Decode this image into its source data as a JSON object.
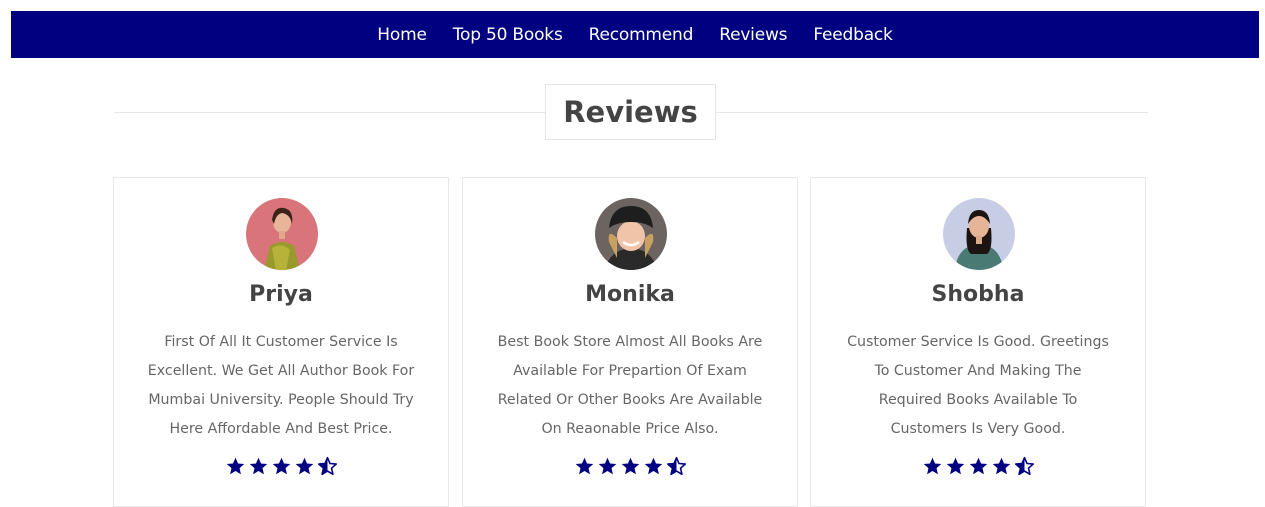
{
  "nav": {
    "items": [
      "Home",
      "Top 50 Books",
      "Recommend",
      "Reviews",
      "Feedback"
    ]
  },
  "section": {
    "title": "Reviews"
  },
  "reviews": [
    {
      "name": "Priya",
      "text": "First Of All It Customer Service Is Excellent. We Get All Author Book For Mumbai University. People Should Try Here Affordable And Best Price.",
      "rating": 4.5
    },
    {
      "name": "Monika",
      "text": "Best Book Store Almost All Books Are Available For Prepartion Of Exam Related Or Other Books Are Available On Reaonable Price Also.",
      "rating": 4.5
    },
    {
      "name": "Shobha",
      "text": "Customer Service Is Good. Greetings To Customer And Making The Required Books Available To Customers Is Very Good.",
      "rating": 4.5
    }
  ],
  "colors": {
    "nav_bg": "#000080",
    "star": "#000080",
    "text": "#666666",
    "heading": "#444444"
  }
}
